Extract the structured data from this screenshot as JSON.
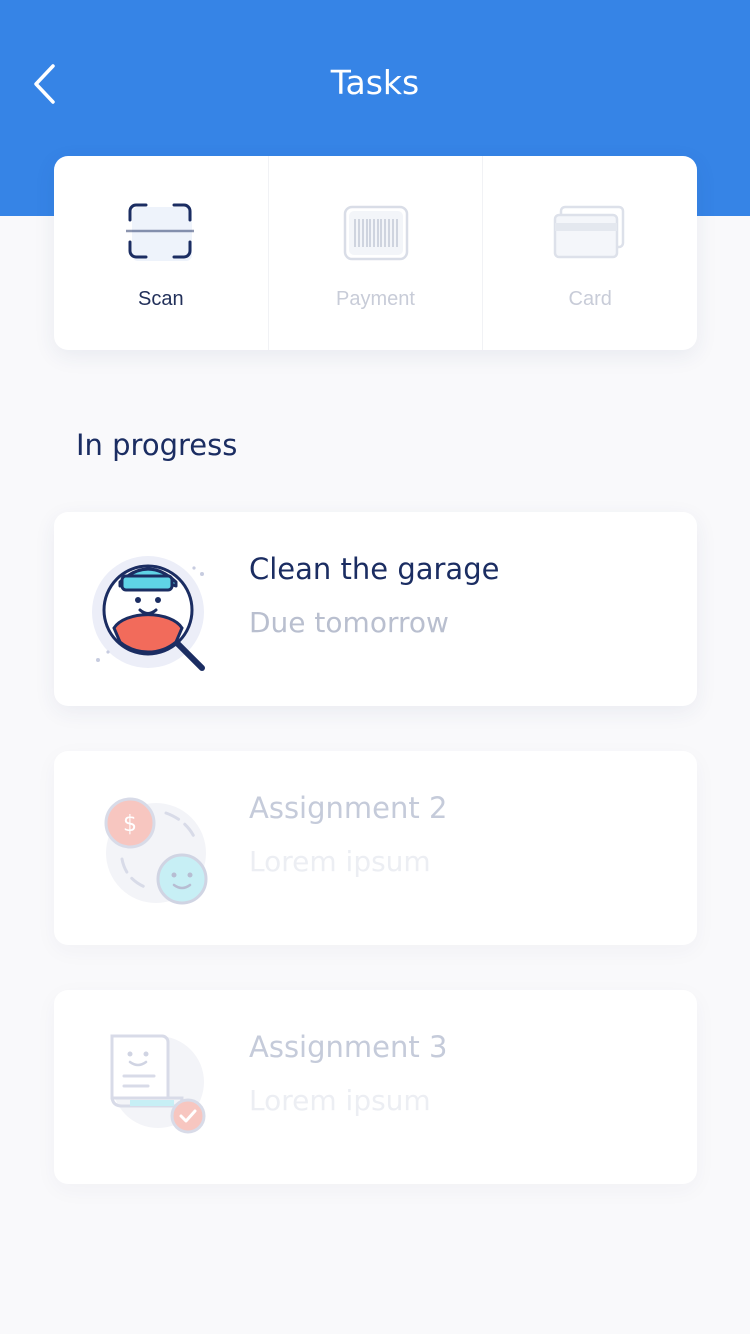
{
  "header": {
    "title": "Tasks",
    "back_icon": "chevron-left-icon",
    "background_color": "#3684e6"
  },
  "actions": [
    {
      "label": "Scan",
      "icon": "scan-icon",
      "active": true
    },
    {
      "label": "Payment",
      "icon": "barcode-icon",
      "active": false
    },
    {
      "label": "Card",
      "icon": "card-icon",
      "active": false
    }
  ],
  "section": {
    "title": "In progress"
  },
  "tasks": [
    {
      "name": "Clean the garage",
      "subtitle": "Due tomorrow",
      "icon": "person-search-icon"
    },
    {
      "name": "Assignment 2",
      "subtitle": "Lorem ipsum",
      "icon": "money-exchange-icon"
    },
    {
      "name": "Assignment 3",
      "subtitle": "Lorem ipsum",
      "icon": "receipt-check-icon"
    }
  ],
  "colors": {
    "primary": "#3684e6",
    "text_dark": "#1b2d62",
    "text_muted": "#b9bfcf",
    "accent_red": "#f26b5b",
    "accent_cyan": "#5fd3e6"
  }
}
